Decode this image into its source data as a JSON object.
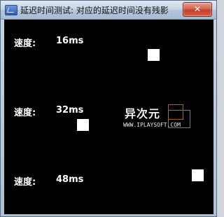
{
  "window": {
    "title": "延迟时间测试: 对应的延迟时间没有残影",
    "close_label": "✕"
  },
  "rows": [
    {
      "label": "速度:",
      "value": "16ms"
    },
    {
      "label": "速度:",
      "value": "32ms"
    },
    {
      "label": "速度:",
      "value": "48ms"
    }
  ],
  "watermark": {
    "title": "异次元",
    "url": "WWW.IPLAYSOFT.COM"
  },
  "colors": {
    "canvas": "#000000",
    "square": "#ffffff"
  }
}
